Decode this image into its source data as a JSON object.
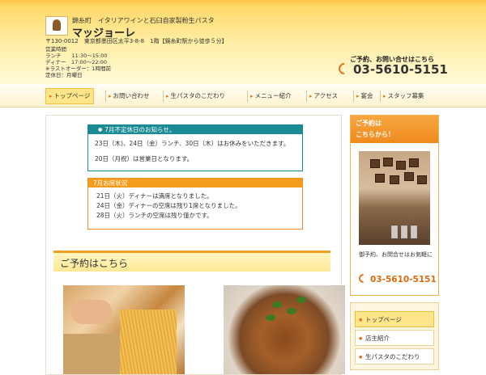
{
  "header": {
    "tagline": "錦糸町　イタリアワインと石臼自家製粉生パスタ",
    "shop_name": "マッジョーレ",
    "address": "〒130-0012　東京都墨田区太平3-8-8　1階【錦糸町駅から徒歩５分】",
    "hours": [
      "営業時間",
      "ランチ　　11:30〜15:00",
      "ディナー　17:00〜22:00",
      "※ラストオーダー：1時間前",
      "定休日：月曜日"
    ],
    "contact_label": "ご予約、お問い合せはこちら",
    "phone": "03-5610-5151"
  },
  "nav": {
    "items": [
      {
        "label": "トップページ"
      },
      {
        "label": "お問い合わせ"
      },
      {
        "label": "生パスタのこだわり"
      },
      {
        "label": "メニュー紹介"
      },
      {
        "label": "アクセス"
      },
      {
        "label": "宴会"
      },
      {
        "label": "スタッフ募集"
      }
    ]
  },
  "notice_holiday": {
    "title": "7月不定休日のお知らせ。",
    "lines": [
      "23日（木)、24日（金）ランチ、30日（木）はお休みをいただきます。",
      "20日（月祝）は営業日となります。"
    ]
  },
  "notice_seats": {
    "title": "7月お席状況",
    "lines": [
      "21日（火）ディナーは満席となりました。",
      "24日（金）ディナーの空席は残り1席となりました。",
      "28日（火）ランチの空席は残り僅かです。"
    ]
  },
  "reservation": {
    "title": "ご予約はこちら"
  },
  "sidebar": {
    "heading": [
      "ご予約は",
      "こちらから！"
    ],
    "text": "御予約、お問合せはお気軽に",
    "phone": "03-5610-5151"
  },
  "sidenav": {
    "items": [
      {
        "label": "トップページ"
      },
      {
        "label": "店主紹介"
      },
      {
        "label": "生パスタのこだわり"
      }
    ]
  },
  "colors": {
    "accent": "#f39c1e",
    "teal": "#1a8b95",
    "phone": "#d96a10"
  }
}
